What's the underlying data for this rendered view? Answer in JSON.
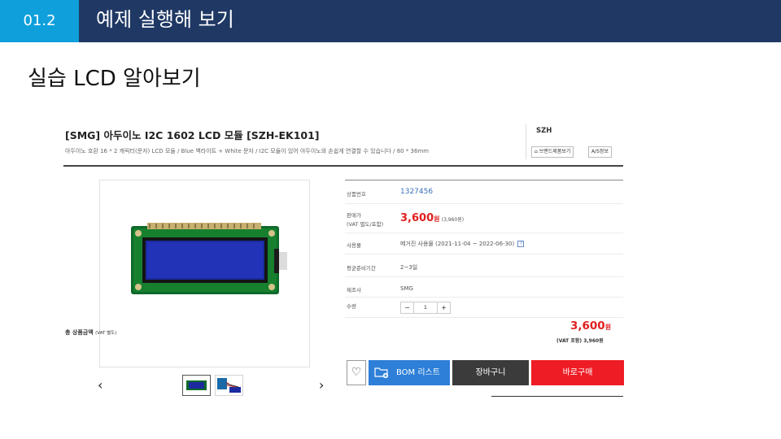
{
  "slide": {
    "section_number": "01.2",
    "section_title": "예제 실행해 보기",
    "subtitle": "실습 LCD 알아보기"
  },
  "product": {
    "title": "[SMG] 아두이노 I2C 1602 LCD 모듈 [SZH-EK101]",
    "description": "아두이노 호환 16 * 2 캐릭터(문자) LCD 모듈 / Blue 백라이트 + White 문자 / I2C 모듈이 있어 아두이노와 손쉽게 연결할 수 있습니다 / 80 * 36mm",
    "brand": "SZH",
    "brand_button": "브랜드제품보기",
    "as_button": "A/S정보",
    "prev_arrow": "‹",
    "next_arrow": "›"
  },
  "info": {
    "code_label": "상품번호",
    "code_value": "1327456",
    "price_label_1": "판매가",
    "price_label_2": "(VAT 별도/포함)",
    "price_value": "3,600",
    "price_unit": "원",
    "price_vat": "(3,960원)",
    "usage_label": "사용몰",
    "usage_value": "메거진 사용몰 (2021-11-04 ~ 2022-06-30)",
    "usage_help": "?",
    "prep_label": "평균준비기간",
    "prep_value": "2~3일",
    "maker_label": "제조사",
    "maker_value": "SMG",
    "qty_label": "수량",
    "qty_minus": "−",
    "qty_value": "1",
    "qty_plus": "+"
  },
  "total": {
    "label": "총 상품금액",
    "label_vat": "(VAT 별도)",
    "price": "3,600",
    "unit": "원",
    "vat_line": "(VAT 포함) 3,960원"
  },
  "buttons": {
    "bom": "BOM 리스트",
    "cart": "장바구니",
    "buy": "바로구매"
  },
  "colors": {
    "header_bar": "#1f3864",
    "section_tab": "#0fa0dc",
    "price_red": "#e02020",
    "bom_blue": "#2d7fd8",
    "cart_dark": "#3b3b3b",
    "buy_red": "#ee1c25"
  }
}
